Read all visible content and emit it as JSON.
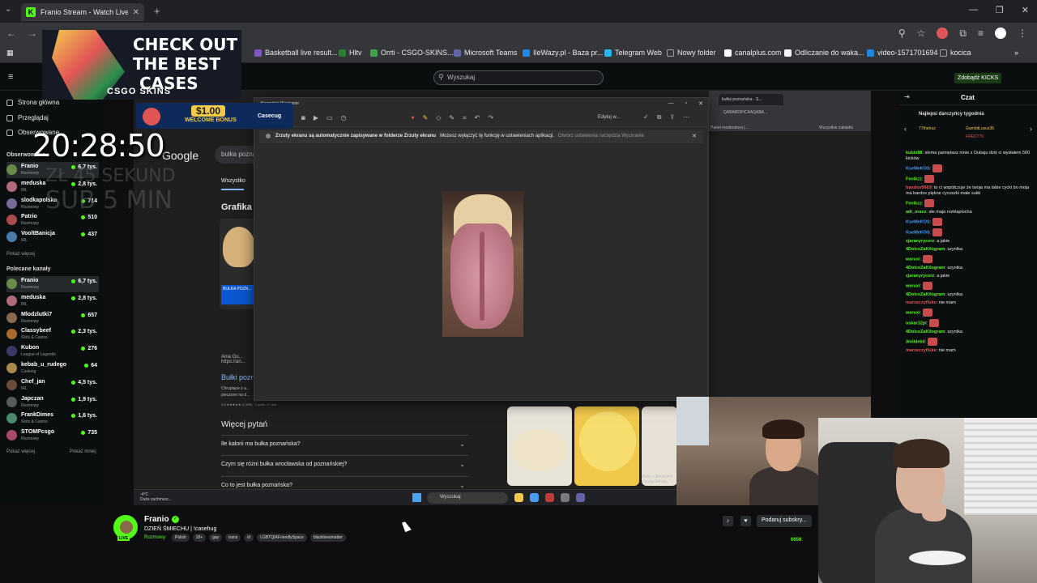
{
  "browser": {
    "tab_title": "Franio Stream - Watch Live",
    "tab_icon": "K",
    "bookmarks": [
      {
        "label": "Basketball live result...",
        "color": "#7e57c2"
      },
      {
        "label": "Hltv",
        "color": "#2e7d32"
      },
      {
        "label": "Orrti - CSGO-SKINS...",
        "color": "#43a047"
      },
      {
        "label": "Microsoft Teams",
        "color": "#6264a7"
      },
      {
        "label": "IleWazy.pl - Baza pr...",
        "color": "#1e88e5"
      },
      {
        "label": "Telegram Web",
        "color": "#29b6f6"
      },
      {
        "label": "Nowy folder",
        "color": "#9e9e9e"
      },
      {
        "label": "canalplus.com",
        "color": "#ffffff"
      },
      {
        "label": "Odliczanie do waka...",
        "color": "#f5f5f5"
      },
      {
        "label": "video-1571701694",
        "color": "#1e88e5"
      },
      {
        "label": "kocica",
        "color": "#9e9e9e"
      }
    ]
  },
  "kick": {
    "search_placeholder": "Wyszukaj",
    "kicks_button": "Zdobądź KICKS",
    "sidebar": {
      "nav": [
        "Strona główna",
        "Przeglądaj",
        "Obserwowane"
      ],
      "followed_header": "Obserwowane",
      "followed": [
        {
          "name": "Franio",
          "category": "Rozmowy",
          "viewers": "6,7 tys.",
          "color": "#6a8a4a",
          "active": true
        },
        {
          "name": "meduska",
          "category": "IRL",
          "viewers": "2,8 tys.",
          "color": "#b06a7a",
          "active": false
        },
        {
          "name": "slodkapolska",
          "category": "Rozmowy",
          "viewers": "714",
          "color": "#7a6a9a",
          "active": false
        },
        {
          "name": "Patrio",
          "category": "Rozmowy",
          "viewers": "510",
          "color": "#aa4a4a",
          "active": false
        },
        {
          "name": "VooltBanicja",
          "category": "IRL",
          "viewers": "437",
          "color": "#4a7aaa",
          "active": false
        }
      ],
      "show_more": "Pokaż więcej",
      "recommended_header": "Polecane kanały",
      "recommended": [
        {
          "name": "Franio",
          "category": "Rozmowy",
          "viewers": "6,7 tys.",
          "color": "#6a8a4a",
          "active": true
        },
        {
          "name": "meduska",
          "category": "IRL",
          "viewers": "2,8 tys.",
          "color": "#b06a7a",
          "active": false
        },
        {
          "name": "Mlodzlutki7",
          "category": "Rozmowy",
          "viewers": "657",
          "color": "#8a6a4a",
          "active": false
        },
        {
          "name": "Classybeef",
          "category": "Slots & Casino",
          "viewers": "2,3 tys.",
          "color": "#aa6a2a",
          "active": false
        },
        {
          "name": "Kubon",
          "category": "League of Legends",
          "viewers": "276",
          "color": "#3a3a6a",
          "active": false
        },
        {
          "name": "kebab_u_rudego",
          "category": "Cooking",
          "viewers": "64",
          "color": "#aa8a4a",
          "active": false
        },
        {
          "name": "Chef_jan",
          "category": "IRL",
          "viewers": "4,5 tys.",
          "color": "#6a4a3a",
          "active": false
        },
        {
          "name": "Japczan",
          "category": "Rozmowy",
          "viewers": "1,9 tys.",
          "color": "#5a5a5a",
          "active": false
        },
        {
          "name": "FrankDimes",
          "category": "Slots & Casino",
          "viewers": "1,6 tys.",
          "color": "#4a8a6a",
          "active": false
        },
        {
          "name": "STOMPcsgo",
          "category": "Rozmowy",
          "viewers": "735",
          "color": "#aa4a6a",
          "active": false
        }
      ],
      "show_more_2": "Pokaż więcej",
      "show_less": "Pokaż mniej"
    }
  },
  "stream_overlay": {
    "ad_line1": "CHECK OUT",
    "ad_line2": "THE BEST",
    "ad_line3": "CASES",
    "ad_brand": "CSGO SKINS",
    "bonus_amount": "$1.00",
    "bonus_label": "WELCOME BONUS",
    "bonus_brand": "Casecug",
    "clock": "20:28:50",
    "ghost_line1": "ZŁ  45 SEKUND",
    "ghost_line2": "SUB  5 MIN"
  },
  "screen": {
    "google_logo": "Google",
    "google_query": "bulka pozna",
    "tab_all": "Wszystko",
    "grafika": "Grafika",
    "result_source": "Ania Go...",
    "result_url": "https://an...",
    "result_title": "Bułki pozn...",
    "result_snippet": "Chrupiące z a... pieczone na d...",
    "result_rating": "4,8 ★★★★★ (1 300) · 1 godz. 47 min",
    "more_questions": "Więcej pytań",
    "faq": [
      "Ile kalorii ma bułka poznańska?",
      "Czym się różni bułka wrocławska od poznańskiej?",
      "Co to jest bułka poznańska?"
    ],
    "right_tab": "bułka poznańska - S...",
    "right_address": "QABABDIHCAAQABA...",
    "moderator_panel": "Panel moderatora |...",
    "all_bookmarks": "Wszystkie zakładki",
    "bulki_caption": "Bułki z Biedronki Czytaj Składu",
    "snip_title": "Narzędzie Wycinanie",
    "snip_edit": "Edytuj w...",
    "snip_notice_bold": "Zrzuty ekranu są automatycznie zapisywane w folderze Zrzuty ekranu",
    "snip_notice_rest": "Możesz wyłączyć tę funkcję w ustawieniach aplikacji.",
    "snip_notice_link": "Otwórz ustawienia narzędzia Wycinanie",
    "taskbar_weather": "Duże zachmurz...",
    "taskbar_temp": "-4°C",
    "taskbar_search": "Wyszukaj"
  },
  "channel": {
    "name": "Franio",
    "title": "DZIEŃ ŚMIECHU | !casehug",
    "category": "Rozmowy",
    "live_badge": "LIVE",
    "tags": [
      "Polish",
      "18+",
      "gay",
      "trans",
      "irl",
      "LGBTQIAFriendlySpace",
      "blacklivesmatter"
    ],
    "subscribe": "Podaruj subskry...",
    "viewers": "6656"
  },
  "chat": {
    "title": "Czat",
    "gifters_header": "Najlepsi darczyńcy tygodnia",
    "gifter1": "77thetruz",
    "gifter2": "GambitLuxus35",
    "gifter3": "FRED779",
    "messages": [
      {
        "user": "kubix88",
        "color": "#53fc18",
        "text": "siema pamiętasz mnie z Dubaju dziś ci wysłałem 500 kicków"
      },
      {
        "user": "KseMeKOS",
        "color": "#4a9af0",
        "text": ""
      },
      {
        "user": "Fenikzz",
        "color": "#53fc18",
        "text": ""
      },
      {
        "user": "bandov9669",
        "color": "#e25555",
        "text": "to ci współczuje że twoja ma takie cycki bo moja ma bardzo piękne cycuszki małe sutki"
      },
      {
        "user": "Fenikzz",
        "color": "#53fc18",
        "text": ""
      },
      {
        "user": "adi_oracz",
        "color": "#53fc18",
        "text": "ale maja rozklapiocha"
      },
      {
        "user": "KseMeKOS",
        "color": "#4a9af0",
        "text": ""
      },
      {
        "user": "KseMeKOS",
        "color": "#4a9af0",
        "text": ""
      },
      {
        "user": "zjaranyrycerz",
        "color": "#53fc18",
        "text": "a jakie"
      },
      {
        "user": "4DolceZaKilogram",
        "color": "#53fc18",
        "text": "szyntka"
      },
      {
        "user": "waruxi",
        "color": "#53fc18",
        "text": ""
      },
      {
        "user": "4DolceZaKilogram",
        "color": "#53fc18",
        "text": "szyntka"
      },
      {
        "user": "zjaranyrycerz",
        "color": "#53fc18",
        "text": "a jakie"
      },
      {
        "user": "waruxi",
        "color": "#53fc18",
        "text": ""
      },
      {
        "user": "4DolceZaKilogram",
        "color": "#53fc18",
        "text": "szyntka"
      },
      {
        "user": "marzeczyfluke",
        "color": "#e25555",
        "text": "nie mam"
      },
      {
        "user": "waruxi",
        "color": "#53fc18",
        "text": ""
      },
      {
        "user": "oskar12pl",
        "color": "#53fc18",
        "text": ""
      },
      {
        "user": "4DolceZaKilogram",
        "color": "#53fc18",
        "text": "szyntka"
      },
      {
        "user": "3mildebil",
        "color": "#53fc18",
        "text": ""
      },
      {
        "user": "marzeczyfluke",
        "color": "#e25555",
        "text": "nie mam"
      }
    ]
  }
}
